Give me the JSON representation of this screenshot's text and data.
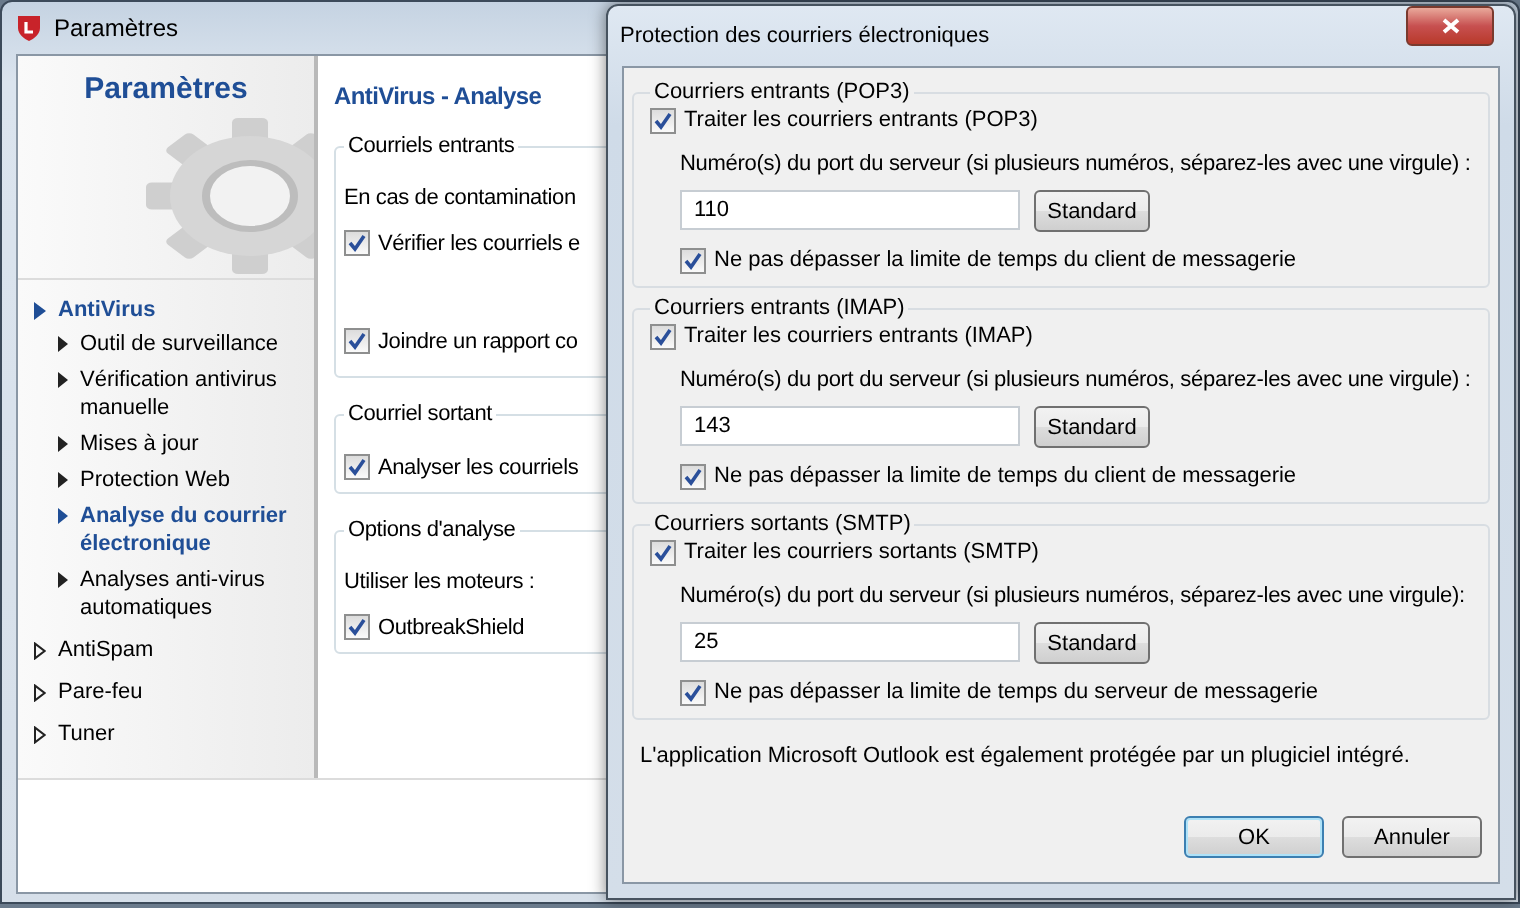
{
  "main_window": {
    "title": "Paramètres",
    "sidebar": {
      "heading": "Paramètres",
      "items": [
        {
          "label": "AntiVirus",
          "expanded": true,
          "children": [
            {
              "label": "Outil de surveillance",
              "selected": false
            },
            {
              "label": "Vérification antivirus manuelle",
              "selected": false
            },
            {
              "label": "Mises à jour",
              "selected": false
            },
            {
              "label": "Protection Web",
              "selected": false
            },
            {
              "label": "Analyse du courrier électronique",
              "selected": true
            },
            {
              "label": "Analyses anti-virus automatiques",
              "selected": false
            }
          ]
        },
        {
          "label": "AntiSpam",
          "expanded": false
        },
        {
          "label": "Pare-feu",
          "expanded": false
        },
        {
          "label": "Tuner",
          "expanded": false
        }
      ]
    },
    "content": {
      "heading": "AntiVirus - Analyse",
      "groups": [
        {
          "title": "Courriels entrants",
          "rows": [
            {
              "kind": "text",
              "label": "En cas de contamination"
            },
            {
              "kind": "checkbox",
              "label": "Vérifier les courriels e",
              "checked": true
            },
            {
              "kind": "checkbox",
              "label": "Joindre un rapport co",
              "checked": true
            }
          ]
        },
        {
          "title": "Courriel sortant",
          "rows": [
            {
              "kind": "checkbox",
              "label": "Analyser les courriels",
              "checked": true
            }
          ]
        },
        {
          "title": "Options d'analyse",
          "rows": [
            {
              "kind": "text",
              "label": "Utiliser les moteurs :"
            },
            {
              "kind": "checkbox",
              "label": "OutbreakShield",
              "checked": true
            }
          ]
        }
      ]
    }
  },
  "dialog": {
    "title": "Protection des courriers électroniques",
    "groups": [
      {
        "title": "Courriers entrants (POP3)",
        "enable": {
          "label": "Traiter les courriers entrants (POP3)",
          "checked": true
        },
        "port_label": "Numéro(s) du port du serveur (si plusieurs numéros, séparez-les avec une virgule) :",
        "port_value": "110",
        "default_button": "Standard",
        "timeout": {
          "label": "Ne pas dépasser la limite de temps du client de messagerie",
          "checked": true
        }
      },
      {
        "title": "Courriers entrants (IMAP)",
        "enable": {
          "label": "Traiter les courriers entrants (IMAP)",
          "checked": true
        },
        "port_label": "Numéro(s) du port du serveur (si plusieurs numéros, séparez-les avec une virgule) :",
        "port_value": "143",
        "default_button": "Standard",
        "timeout": {
          "label": "Ne pas dépasser la limite de temps du client de messagerie",
          "checked": true
        }
      },
      {
        "title": "Courriers sortants (SMTP)",
        "enable": {
          "label": "Traiter les courriers sortants (SMTP)",
          "checked": true
        },
        "port_label": "Numéro(s) du port du serveur (si plusieurs numéros, séparez-les avec une virgule):",
        "port_value": "25",
        "default_button": "Standard",
        "timeout": {
          "label": "Ne pas dépasser la limite de temps du serveur de messagerie",
          "checked": true
        }
      }
    ],
    "note": "L'application Microsoft Outlook est également protégée par un plugiciel intégré.",
    "buttons": [
      {
        "label": "OK",
        "default": true
      },
      {
        "label": "Annuler",
        "default": false
      }
    ]
  }
}
